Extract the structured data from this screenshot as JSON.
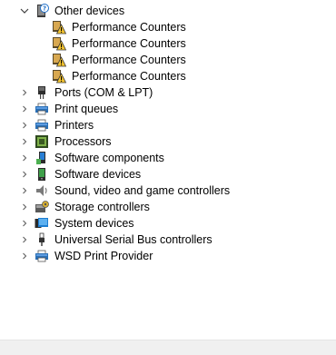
{
  "tree": {
    "items": [
      {
        "label": "Other devices",
        "state": "expanded",
        "icon": "unknown-device-icon",
        "level": 0
      },
      {
        "label": "Performance Counters",
        "state": "leaf",
        "icon": "warning-device-icon",
        "level": 1
      },
      {
        "label": "Performance Counters",
        "state": "leaf",
        "icon": "warning-device-icon",
        "level": 1
      },
      {
        "label": "Performance Counters",
        "state": "leaf",
        "icon": "warning-device-icon",
        "level": 1
      },
      {
        "label": "Performance Counters",
        "state": "leaf",
        "icon": "warning-device-icon",
        "level": 1
      },
      {
        "label": "Ports (COM & LPT)",
        "state": "collapsed",
        "icon": "port-icon",
        "level": 0
      },
      {
        "label": "Print queues",
        "state": "collapsed",
        "icon": "printer-icon",
        "level": 0
      },
      {
        "label": "Printers",
        "state": "collapsed",
        "icon": "printer-icon",
        "level": 0
      },
      {
        "label": "Processors",
        "state": "collapsed",
        "icon": "processor-icon",
        "level": 0
      },
      {
        "label": "Software components",
        "state": "collapsed",
        "icon": "software-component-icon",
        "level": 0
      },
      {
        "label": "Software devices",
        "state": "collapsed",
        "icon": "software-device-icon",
        "level": 0
      },
      {
        "label": "Sound, video and game controllers",
        "state": "collapsed",
        "icon": "speaker-icon",
        "level": 0
      },
      {
        "label": "Storage controllers",
        "state": "collapsed",
        "icon": "storage-controller-icon",
        "level": 0
      },
      {
        "label": "System devices",
        "state": "collapsed",
        "icon": "system-devices-icon",
        "level": 0
      },
      {
        "label": "Universal Serial Bus controllers",
        "state": "collapsed",
        "icon": "usb-icon",
        "level": 0
      },
      {
        "label": "WSD Print Provider",
        "state": "collapsed",
        "icon": "printer-icon",
        "level": 0
      }
    ]
  },
  "colors": {
    "background": "#ffffff",
    "text": "#000000",
    "chevron": "#606060",
    "scrollbar": "#f0f0f0"
  }
}
